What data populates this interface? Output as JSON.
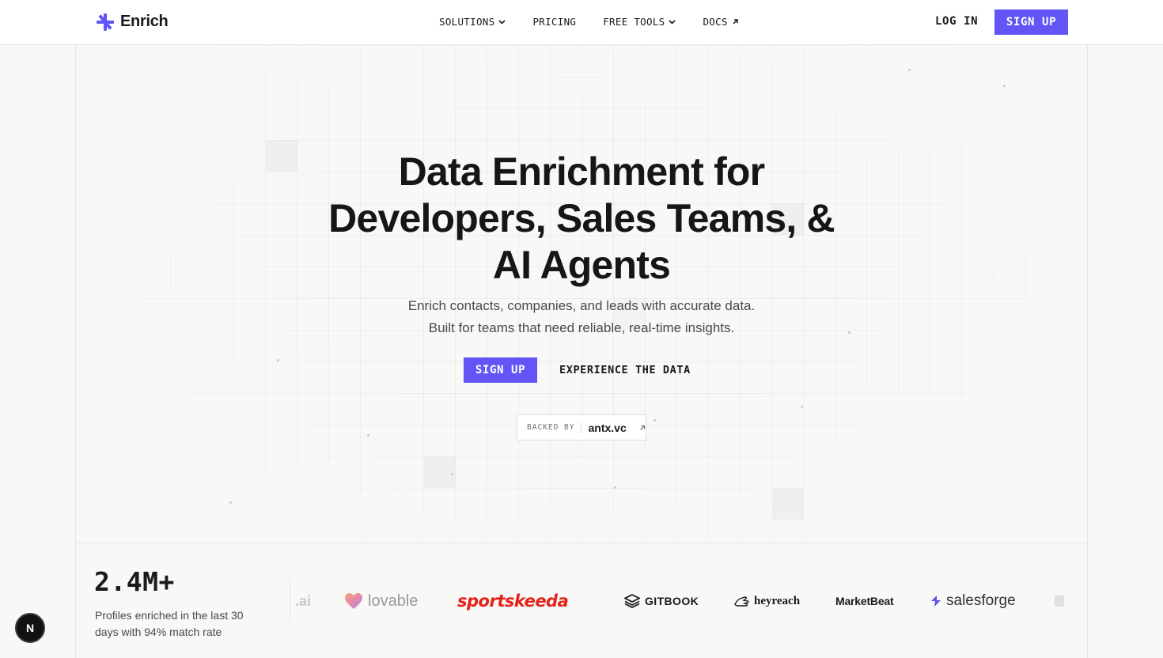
{
  "brand": {
    "name": "Enrich",
    "accent": "#6355f5"
  },
  "nav": {
    "items": [
      {
        "label": "SOLUTIONS",
        "icon": "chevron-down-icon"
      },
      {
        "label": "PRICING"
      },
      {
        "label": "FREE TOOLS",
        "icon": "chevron-down-icon"
      },
      {
        "label": "DOCS",
        "icon": "arrow-up-right-icon"
      }
    ],
    "login": "LOG IN",
    "signup": "SIGN UP"
  },
  "hero": {
    "title_line1": "Data Enrichment for",
    "title_line2": "Developers, Sales Teams, &",
    "title_line3": "AI Agents",
    "subtitle_line1": "Enrich contacts, companies, and leads with accurate data.",
    "subtitle_line2": "Built for teams that need reliable, real-time insights.",
    "cta_primary": "SIGN UP",
    "cta_secondary": "EXPERIENCE THE DATA",
    "backed_label": "BACKED BY",
    "backed_name": "antx.vc"
  },
  "stats": {
    "number": "2.4M+",
    "description": "Profiles enriched in the last 30 days with 94% match rate"
  },
  "logos": {
    "ai": ".ai",
    "lovable": "lovable",
    "sportskeeda": "sportskeeda",
    "gitbook": "GITBOOK",
    "heyreach": "heyreach",
    "marketbeat": "MarketBeat",
    "salesforge": "salesforge"
  },
  "badge": {
    "letter": "N"
  }
}
